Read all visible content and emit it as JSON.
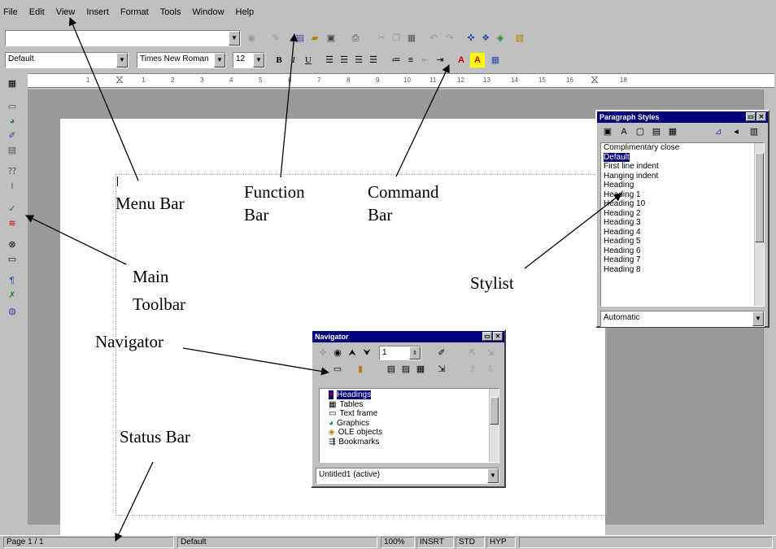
{
  "menubar": {
    "items": [
      {
        "label": "File"
      },
      {
        "label": "Edit"
      },
      {
        "label": "View"
      },
      {
        "label": "Insert"
      },
      {
        "label": "Format"
      },
      {
        "label": "Tools"
      },
      {
        "label": "Window"
      },
      {
        "label": "Help"
      }
    ]
  },
  "functionbar": {
    "url_value": ""
  },
  "commandbar": {
    "style_value": "Default",
    "font_value": "Times New Roman",
    "size_value": "12",
    "bold": "B",
    "italic": "I",
    "underline": "U",
    "font_color": "A",
    "highlight": "A"
  },
  "ruler": {
    "ticks": [
      "1",
      "1",
      "2",
      "3",
      "4",
      "5",
      "6",
      "7",
      "8",
      "9",
      "10",
      "11",
      "12",
      "13",
      "14",
      "15",
      "16",
      "18"
    ]
  },
  "paragraph_styles": {
    "title": "Paragraph Styles",
    "items": [
      {
        "label": "Complimentary close"
      },
      {
        "label": "Default",
        "selected": true
      },
      {
        "label": "First line indent"
      },
      {
        "label": "Hanging indent"
      },
      {
        "label": "Heading"
      },
      {
        "label": "Heading 1"
      },
      {
        "label": "Heading 10"
      },
      {
        "label": "Heading 2"
      },
      {
        "label": "Heading 3"
      },
      {
        "label": "Heading 4"
      },
      {
        "label": "Heading 5"
      },
      {
        "label": "Heading 6"
      },
      {
        "label": "Heading 7"
      },
      {
        "label": "Heading 8"
      }
    ],
    "filter_value": "Automatic"
  },
  "navigator": {
    "title": "Navigator",
    "page_value": "1",
    "items": [
      {
        "label": "Headings",
        "icon": "headings-icon",
        "selected": true
      },
      {
        "label": "Tables",
        "icon": "table-icon"
      },
      {
        "label": "Text frame",
        "icon": "frame-icon"
      },
      {
        "label": "Graphics",
        "icon": "graphics-icon"
      },
      {
        "label": "OLE objects",
        "icon": "ole-icon"
      },
      {
        "label": "Bookmarks",
        "icon": "bookmark-icon"
      }
    ],
    "document_value": "Untitled1 (active)"
  },
  "statusbar": {
    "page": "Page 1 / 1",
    "style": "Default",
    "zoom": "100%",
    "insert_mode": "INSRT",
    "selection_mode": "STD",
    "hyperlink_mode": "HYP"
  },
  "annotations": {
    "menu_bar": "Menu Bar",
    "function_bar_1": "Function",
    "function_bar_2": "Bar",
    "command_bar_1": "Command",
    "command_bar_2": "Bar",
    "main_toolbar_1": "Main",
    "main_toolbar_2": "Toolbar",
    "stylist": "Stylist",
    "navigator": "Navigator",
    "status_bar": "Status Bar"
  }
}
